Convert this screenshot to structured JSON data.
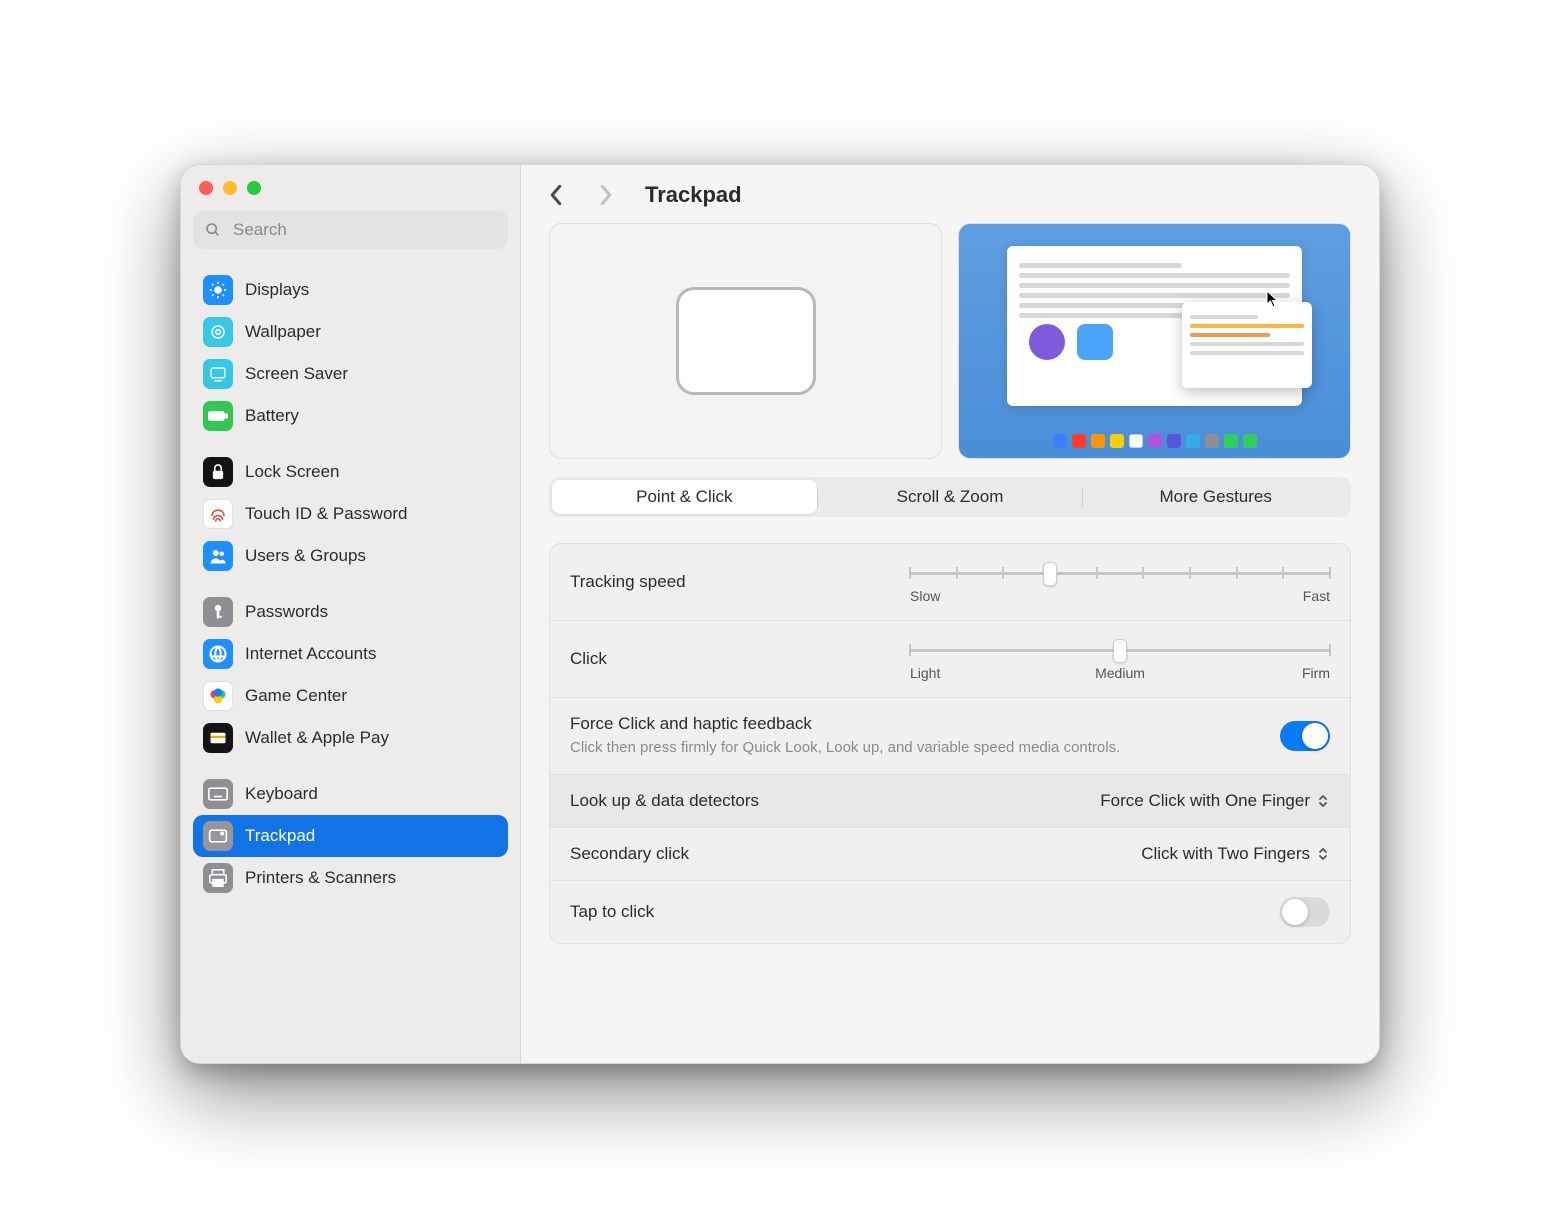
{
  "search": {
    "placeholder": "Search"
  },
  "header": {
    "title": "Trackpad"
  },
  "sidebar": {
    "groups": [
      {
        "items": [
          {
            "key": "displays",
            "label": "Displays"
          },
          {
            "key": "wallpaper",
            "label": "Wallpaper"
          },
          {
            "key": "screensaver",
            "label": "Screen Saver"
          },
          {
            "key": "battery",
            "label": "Battery"
          }
        ]
      },
      {
        "items": [
          {
            "key": "lock",
            "label": "Lock Screen"
          },
          {
            "key": "touchid",
            "label": "Touch ID & Password"
          },
          {
            "key": "users",
            "label": "Users & Groups"
          }
        ]
      },
      {
        "items": [
          {
            "key": "passwords",
            "label": "Passwords"
          },
          {
            "key": "internet",
            "label": "Internet Accounts"
          },
          {
            "key": "game",
            "label": "Game Center"
          },
          {
            "key": "wallet",
            "label": "Wallet & Apple Pay"
          }
        ]
      },
      {
        "items": [
          {
            "key": "keyboard",
            "label": "Keyboard"
          },
          {
            "key": "trackpad",
            "label": "Trackpad",
            "selected": true
          },
          {
            "key": "printers",
            "label": "Printers & Scanners"
          }
        ]
      }
    ]
  },
  "tabs": {
    "items": [
      {
        "label": "Point & Click",
        "active": true
      },
      {
        "label": "Scroll & Zoom"
      },
      {
        "label": "More Gestures"
      }
    ]
  },
  "settings": {
    "tracking": {
      "label": "Tracking speed",
      "min_label": "Slow",
      "max_label": "Fast",
      "ticks": 10,
      "value_index": 3
    },
    "click": {
      "label": "Click",
      "min_label": "Light",
      "mid_label": "Medium",
      "max_label": "Firm",
      "ticks": 3,
      "value_index": 1
    },
    "force_click": {
      "label": "Force Click and haptic feedback",
      "description": "Click then press firmly for Quick Look, Look up, and variable speed media controls.",
      "on": true
    },
    "lookup": {
      "label": "Look up & data detectors",
      "value": "Force Click with One Finger"
    },
    "secondary": {
      "label": "Secondary click",
      "value": "Click with Two Fingers"
    },
    "tap": {
      "label": "Tap to click",
      "on": false
    }
  },
  "dock_colors": [
    "#3a82f7",
    "#ff3b30",
    "#ff9500",
    "#ffcc00",
    "#ffffff",
    "#af52de",
    "#5856d6",
    "#32ade6",
    "#8e8e93",
    "#30d158",
    "#30d158"
  ]
}
